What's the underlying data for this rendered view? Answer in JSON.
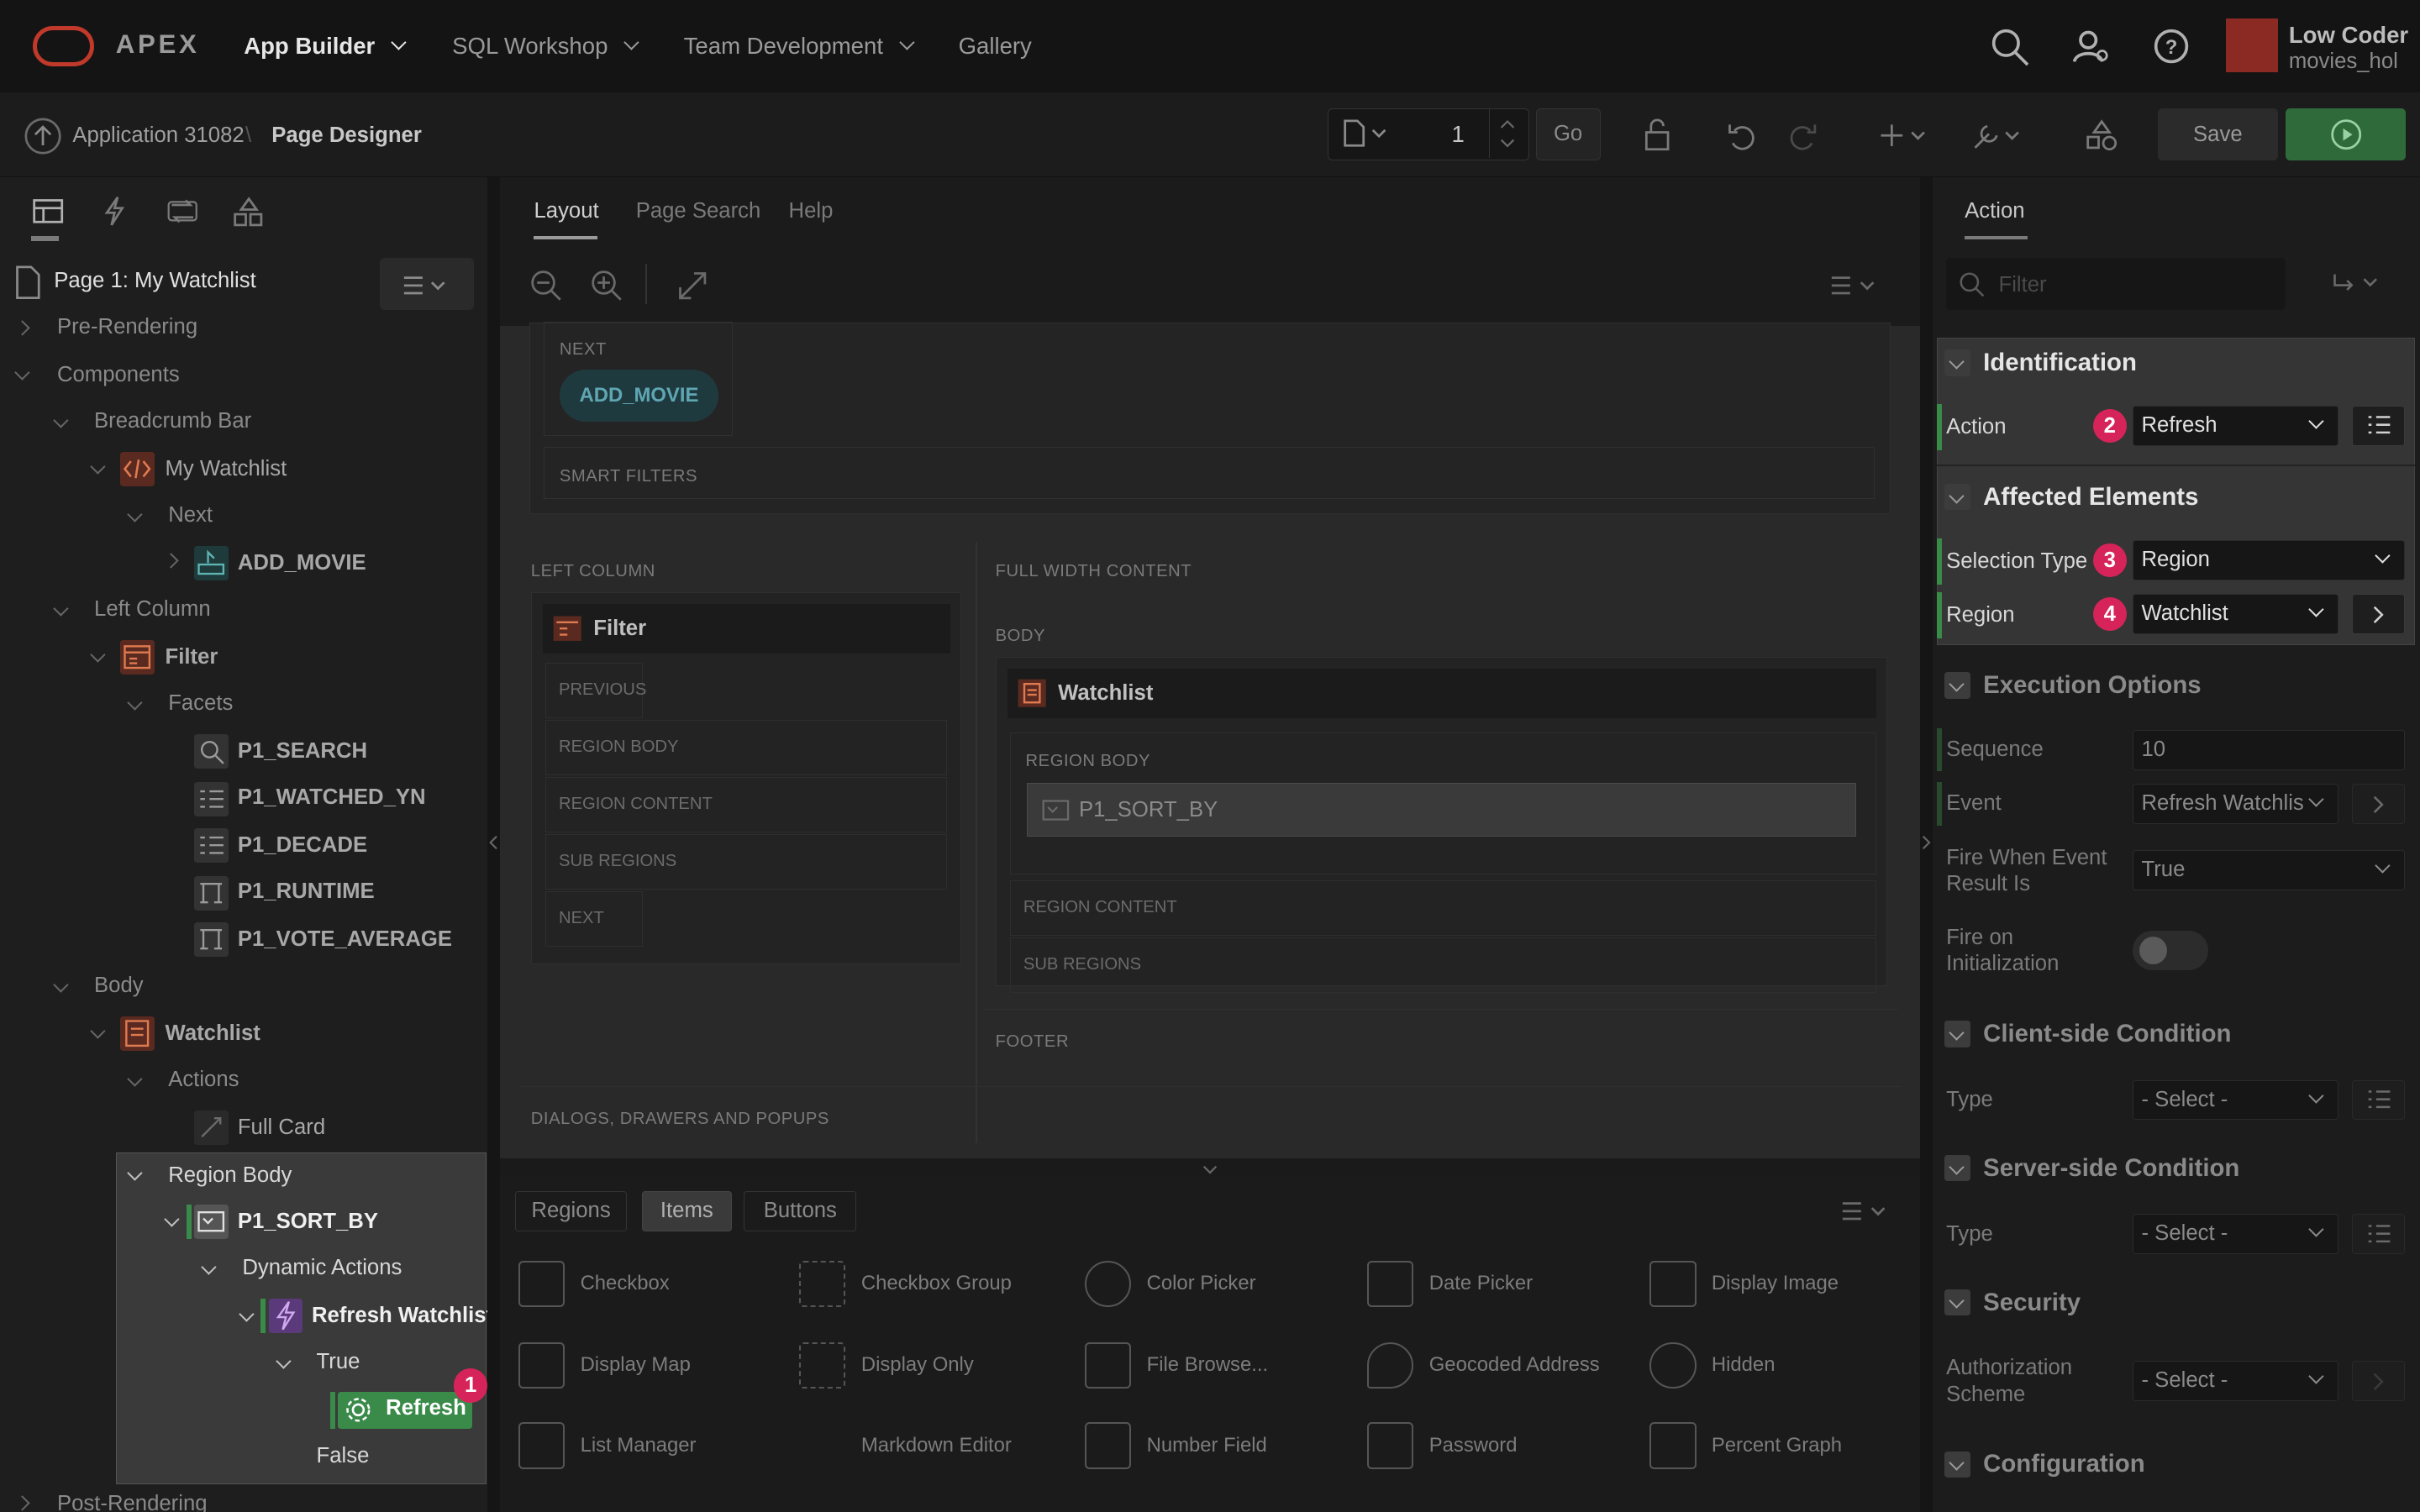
{
  "topbar": {
    "brand": "APEX",
    "nav": [
      "App Builder",
      "SQL Workshop",
      "Team Development",
      "Gallery"
    ],
    "user_name": "Low Coder",
    "user_workspace": "movies_hol"
  },
  "subbar": {
    "application": "Application 31082",
    "page_designer": "Page Designer",
    "page_number": "1",
    "go_label": "Go",
    "save_label": "Save"
  },
  "left": {
    "page_title": "Page 1: My Watchlist",
    "tree": {
      "pre_rendering": "Pre-Rendering",
      "components": "Components",
      "breadcrumb_bar": "Breadcrumb Bar",
      "my_watchlist": "My Watchlist",
      "next": "Next",
      "add_movie": "ADD_MOVIE",
      "left_column": "Left Column",
      "filter": "Filter",
      "facets": "Facets",
      "facet_items": [
        "P1_SEARCH",
        "P1_WATCHED_YN",
        "P1_DECADE",
        "P1_RUNTIME",
        "P1_VOTE_AVERAGE"
      ],
      "body": "Body",
      "watchlist": "Watchlist",
      "actions": "Actions",
      "full_card": "Full Card",
      "region_body": "Region Body",
      "p1_sort_by": "P1_SORT_BY",
      "dynamic_actions": "Dynamic Actions",
      "refresh_watchlist": "Refresh Watchlist",
      "true": "True",
      "refresh": "Refresh",
      "false": "False",
      "post_rendering": "Post-Rendering"
    }
  },
  "center": {
    "tabs": [
      "Layout",
      "Page Search",
      "Help"
    ],
    "layout": {
      "next": "NEXT",
      "add_movie": "ADD_MOVIE",
      "smart_filters": "SMART FILTERS",
      "left_column": "LEFT COLUMN",
      "full_width_content": "FULL WIDTH CONTENT",
      "filter": "Filter",
      "filter_slots": [
        "PREVIOUS",
        "REGION BODY",
        "REGION CONTENT",
        "SUB REGIONS",
        "NEXT"
      ],
      "body": "BODY",
      "watchlist": "Watchlist",
      "region_body": "REGION BODY",
      "p1_sort_by": "P1_SORT_BY",
      "region_content": "REGION CONTENT",
      "sub_regions": "SUB REGIONS",
      "footer": "FOOTER",
      "dialogs": "DIALOGS, DRAWERS AND POPUPS"
    },
    "gallery_tabs": [
      "Regions",
      "Items",
      "Buttons"
    ],
    "gallery_items": [
      "Checkbox",
      "Checkbox Group",
      "Color Picker",
      "Date Picker",
      "Display Image",
      "Display Map",
      "Display Only",
      "File Browse...",
      "Geocoded Address",
      "Hidden",
      "List Manager",
      "Markdown Editor",
      "Number Field",
      "Password",
      "Percent Graph"
    ]
  },
  "right": {
    "tab": "Action",
    "filter_placeholder": "Filter",
    "identification": "Identification",
    "action_label": "Action",
    "action_value": "Refresh",
    "affected_elements": "Affected Elements",
    "selection_type_label": "Selection Type",
    "selection_type_value": "Region",
    "region_label": "Region",
    "region_value": "Watchlist",
    "execution_options": "Execution Options",
    "sequence_label": "Sequence",
    "sequence_value": "10",
    "event_label": "Event",
    "event_value": "Refresh Watchlis",
    "fire_when_label_1": "Fire When Event",
    "fire_when_label_2": "Result Is",
    "fire_when_value": "True",
    "fire_init_label_1": "Fire on",
    "fire_init_label_2": "Initialization",
    "client_condition": "Client-side Condition",
    "type_label": "Type",
    "select_value": "- Select -",
    "server_condition": "Server-side Condition",
    "security": "Security",
    "auth_label_1": "Authorization",
    "auth_label_2": "Scheme",
    "configuration": "Configuration"
  },
  "badges": [
    "1",
    "2",
    "3",
    "4"
  ],
  "colors": {
    "accent_green": "#3a8a4a",
    "badge_pink": "#d6245a",
    "oracle_red": "#c0392b"
  }
}
